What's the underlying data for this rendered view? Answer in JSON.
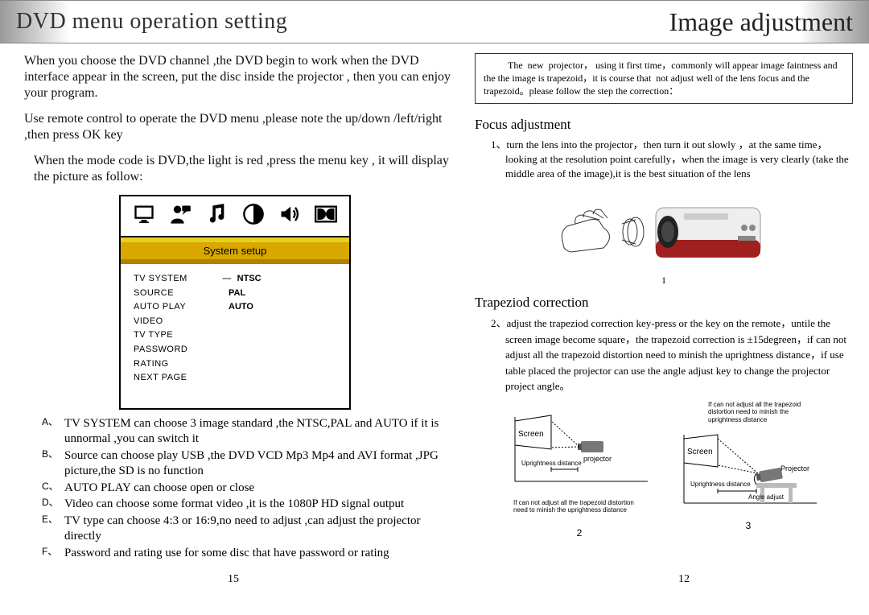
{
  "header": {
    "left_title": "DVD menu operation setting",
    "right_title": "Image adjustment"
  },
  "left": {
    "p1": "When you choose the DVD channel ,the DVD begin to work when the DVD interface appear in the screen, put the disc inside the projector , then you can enjoy your program.",
    "p2": "Use remote control to operate  the DVD menu ,please note the up/down /left/right ,then press OK key",
    "p3": "When the mode code is DVD,the light is red ,press the menu key , it will display the picture as follow:",
    "osd": {
      "tab": "System setup",
      "rows": [
        {
          "k": "TV SYSTEM",
          "dash": "----",
          "v": "NTSC"
        },
        {
          "k": "SOURCE",
          "dash": "",
          "v": "PAL"
        },
        {
          "k": "AUTO PLAY",
          "dash": "",
          "v": "AUTO"
        },
        {
          "k": "VIDEO",
          "dash": "",
          "v": ""
        },
        {
          "k": "TV TYPE",
          "dash": "",
          "v": ""
        },
        {
          "k": "PASSWORD",
          "dash": "",
          "v": ""
        },
        {
          "k": "RATING",
          "dash": "",
          "v": ""
        },
        {
          "k": "NEXT PAGE",
          "dash": "",
          "v": ""
        }
      ]
    },
    "notes": [
      {
        "m": "A、",
        "t": "TV SYSTEM can choose 3 image standard ,the NTSC,PAL and AUTO if it is unnormal ,you can switch it"
      },
      {
        "m": "B、",
        "t": "Source can choose play USB ,the DVD VCD Mp3 Mp4 and AVI format ,JPG picture,the SD is no function"
      },
      {
        "m": "C、",
        "t": "AUTO PLAY can choose open or close"
      },
      {
        "m": "D、",
        "t": "Video can choose some format video ,it is the 1080P HD signal output"
      },
      {
        "m": "E、",
        "t": "TV type can choose 4:3 or 16:9,no need to adjust ,can adjust the projector directly"
      },
      {
        "m": "F、",
        "t": "Password and rating use for some disc that have password or rating"
      }
    ],
    "page": "15"
  },
  "right": {
    "boxed": "          The  new  projector， using it first time，commonly will appear image faintness and the the image is trapezoid，it is course that  not adjust well of the lens focus and the trapezoid。please follow the step the correction：",
    "focus_h": "Focus adjustment",
    "focus_note": "1、turn the lens into the projector，then turn it out  slowly ，at the same time，looking at the resolution point carefully，when the image is very clearly (take the middle area of the image),it is the best situation of the lens",
    "fig1": "1",
    "trap_h": "Trapeziod correction",
    "trap_note": "2、adjust the trapeziod correction key-press or the key on the remote，untile the screen image become square，the trapezoid correction  is ±15degreen，if can not adjust all the trapezoid distortion need to minish the uprightness distance，if use table placed   the projector can use the angle adjust key to change the projector project angle。",
    "d2": {
      "screen": "Screen",
      "upright": "Uprightness distance",
      "proj": "projector",
      "caption": "If can not adjust all the trapezoid distortion need to minish the uprightness distance",
      "fig": "2"
    },
    "d3": {
      "screen": "Screen",
      "upright": "Uprightness distance",
      "proj": "Projector",
      "angle": "Angle adjust",
      "caption": "If can not adjust all the trapezoid distortion need to minish the uprightness distance",
      "fig": "3"
    },
    "page": "12"
  }
}
